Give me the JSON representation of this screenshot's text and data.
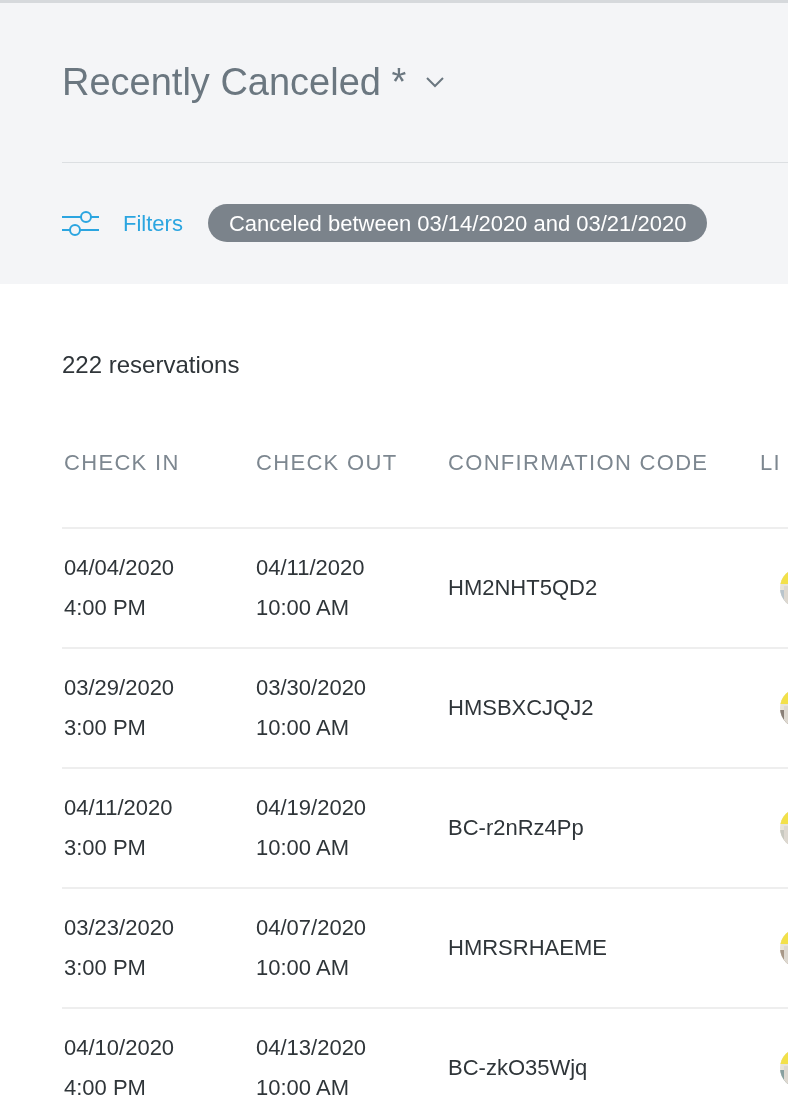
{
  "view": {
    "title": "Recently Canceled *"
  },
  "filters": {
    "label": "Filters",
    "chips": [
      "Canceled between 03/14/2020 and 03/21/2020"
    ]
  },
  "count": "222 reservations",
  "table": {
    "columns": [
      "CHECK IN",
      "CHECK OUT",
      "CONFIRMATION CODE",
      "LI"
    ],
    "rows": [
      {
        "check_in_date": "04/04/2020",
        "check_in_time": "4:00 PM",
        "check_out_date": "04/11/2020",
        "check_out_time": "10:00 AM",
        "code": "HM2NHT5QD2"
      },
      {
        "check_in_date": "03/29/2020",
        "check_in_time": "3:00 PM",
        "check_out_date": "03/30/2020",
        "check_out_time": "10:00 AM",
        "code": "HMSBXCJQJ2"
      },
      {
        "check_in_date": "04/11/2020",
        "check_in_time": "3:00 PM",
        "check_out_date": "04/19/2020",
        "check_out_time": "10:00 AM",
        "code": "BC-r2nRz4Pp"
      },
      {
        "check_in_date": "03/23/2020",
        "check_in_time": "3:00 PM",
        "check_out_date": "04/07/2020",
        "check_out_time": "10:00 AM",
        "code": "HMRSRHAEME"
      },
      {
        "check_in_date": "04/10/2020",
        "check_in_time": "4:00 PM",
        "check_out_date": "04/13/2020",
        "check_out_time": "10:00 AM",
        "code": "BC-zkO35Wjq"
      }
    ]
  }
}
